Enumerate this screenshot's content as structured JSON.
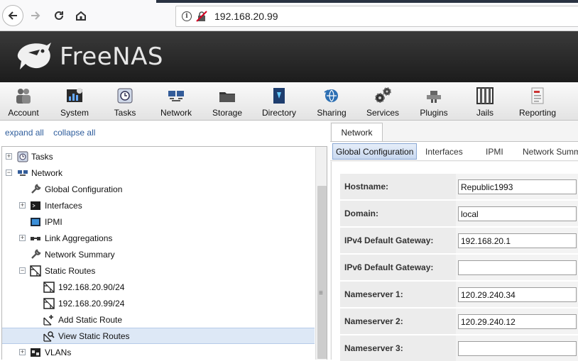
{
  "browser": {
    "url": "192.168.20.99"
  },
  "app": {
    "brand": "FreeNAS"
  },
  "toolbar": {
    "items": [
      {
        "label": "Account",
        "icon": "account-icon"
      },
      {
        "label": "System",
        "icon": "system-icon"
      },
      {
        "label": "Tasks",
        "icon": "tasks-icon"
      },
      {
        "label": "Network",
        "icon": "network-icon"
      },
      {
        "label": "Storage",
        "icon": "storage-icon"
      },
      {
        "label": "Directory",
        "icon": "directory-icon"
      },
      {
        "label": "Sharing",
        "icon": "sharing-icon"
      },
      {
        "label": "Services",
        "icon": "services-icon"
      },
      {
        "label": "Plugins",
        "icon": "plugins-icon"
      },
      {
        "label": "Jails",
        "icon": "jails-icon"
      },
      {
        "label": "Reporting",
        "icon": "reporting-icon"
      }
    ]
  },
  "tree": {
    "expand_all": "expand all",
    "collapse_all": "collapse all",
    "rows": [
      {
        "label": "Tasks",
        "toggle": "+"
      },
      {
        "label": "Network",
        "toggle": "−"
      },
      {
        "label": "Global Configuration"
      },
      {
        "label": "Interfaces",
        "toggle": "+"
      },
      {
        "label": "IPMI"
      },
      {
        "label": "Link Aggregations",
        "toggle": "+"
      },
      {
        "label": "Network Summary"
      },
      {
        "label": "Static Routes",
        "toggle": "−"
      },
      {
        "label": "192.168.20.90/24"
      },
      {
        "label": "192.168.20.99/24"
      },
      {
        "label": "Add Static Route"
      },
      {
        "label": "View Static Routes",
        "selected": true
      },
      {
        "label": "VLANs",
        "toggle": "+"
      }
    ]
  },
  "panel": {
    "tab": "Network",
    "subtabs": [
      "Global Configuration",
      "Interfaces",
      "IPMI",
      "Network Summary"
    ],
    "active_subtab": "Global Configuration",
    "fields": [
      {
        "label": "Hostname:",
        "value": "Republic1993"
      },
      {
        "label": "Domain:",
        "value": "local"
      },
      {
        "label": "IPv4 Default Gateway:",
        "value": "192.168.20.1"
      },
      {
        "label": "IPv6 Default Gateway:",
        "value": ""
      },
      {
        "label": "Nameserver 1:",
        "value": "120.29.240.34"
      },
      {
        "label": "Nameserver 2:",
        "value": "120.29.240.12"
      },
      {
        "label": "Nameserver 3:",
        "value": ""
      }
    ]
  },
  "colors": {
    "header_dark": "#1c1c1c",
    "link_blue": "#2e5d9c",
    "selected_row": "#dde8f6"
  }
}
